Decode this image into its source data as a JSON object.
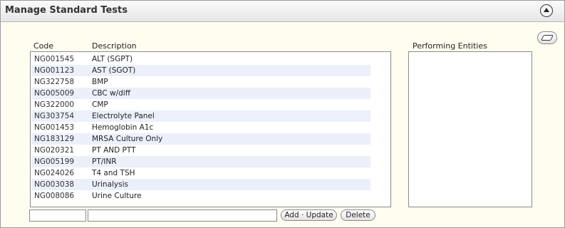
{
  "panel": {
    "title": "Manage Standard Tests"
  },
  "icons": {
    "collapse": "collapse-up-icon",
    "clear": "eraser-icon"
  },
  "columns": {
    "code": "Code",
    "description": "Description",
    "entities": "Performing Entities"
  },
  "tests": [
    {
      "code": "NG001545",
      "description": "ALT (SGPT)"
    },
    {
      "code": "NG001123",
      "description": "AST (SGOT)"
    },
    {
      "code": "NG322758",
      "description": "BMP"
    },
    {
      "code": "NG005009",
      "description": "CBC w/diff"
    },
    {
      "code": "NG322000",
      "description": "CMP"
    },
    {
      "code": "NG303754",
      "description": "Electrolyte Panel"
    },
    {
      "code": "NG001453",
      "description": "Hemoglobin A1c"
    },
    {
      "code": "NG183129",
      "description": "MRSA Culture Only"
    },
    {
      "code": "NG020321",
      "description": "PT AND PTT"
    },
    {
      "code": "NG005199",
      "description": "PT/INR"
    },
    {
      "code": "NG024026",
      "description": "T4 and TSH"
    },
    {
      "code": "NG003038",
      "description": "Urinalysis"
    },
    {
      "code": "NG008086",
      "description": "Urine Culture"
    }
  ],
  "form": {
    "code_value": "",
    "description_value": "",
    "add_update_label": "Add · Update",
    "delete_label": "Delete"
  },
  "colors": {
    "row_alt": "#ecf0fb",
    "panel_bg": "#fffdf0"
  }
}
